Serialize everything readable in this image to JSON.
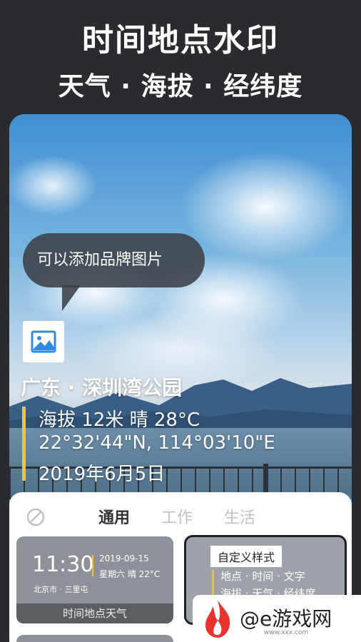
{
  "header": {
    "headline": "时间地点水印",
    "subline": "天气 · 海拔 · 经纬度"
  },
  "preview": {
    "bubble_text": "可以添加品牌图片",
    "brand_image_icon": "image-icon",
    "place": "广东 · 深圳湾公园",
    "altitude_weather": "海拔 12米   晴 28°C",
    "coordinates": "22°32'44\"N, 114°03'10\"E",
    "date": "2019年6月5日"
  },
  "tabs": {
    "none_icon": "no-style-icon",
    "items": [
      "通用",
      "工作",
      "生活"
    ],
    "active_index": 0
  },
  "templates": [
    {
      "time": "11:30",
      "date": "2019-09-15",
      "weather": "星期六 晴 22°C",
      "location": "北京市 · 三里屯",
      "label": "时间地点天气"
    },
    {
      "tag": "自定义样式",
      "line1": "地点 · 时间 · 文字",
      "line2": "海拔 · 天气 · 经纬度"
    }
  ],
  "watermark": {
    "site": "@e游戏网",
    "url": "www.xxx.com"
  },
  "colors": {
    "background": "#2a2b2e",
    "accent_yellow": "#f4c330",
    "logo_red": "#e8322d"
  }
}
